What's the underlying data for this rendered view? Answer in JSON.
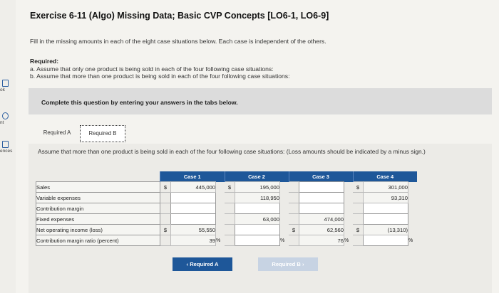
{
  "sidebar": {
    "items": [
      {
        "label": "ok"
      },
      {
        "label": "nt"
      },
      {
        "label": "ences"
      }
    ]
  },
  "title": "Exercise 6-11 (Algo) Missing Data; Basic CVP Concepts [LO6-1, LO6-9]",
  "intro": "Fill in the missing amounts in each of the eight case situations below. Each case is independent of the others.",
  "required": {
    "heading": "Required:",
    "a": "a. Assume that only one product is being sold in each of the four following case situations:",
    "b": "b. Assume that more than one product is being sold in each of the four following case situations:"
  },
  "banner": "Complete this question by entering your answers in the tabs below.",
  "tabs": {
    "a": "Required A",
    "b": "Required B"
  },
  "instruction": "Assume that more than one product is being sold in each of the four following case situations: (Loss amounts should be indicated by a minus sign.)",
  "table": {
    "headers": [
      "Case 1",
      "Case 2",
      "Case 3",
      "Case 4"
    ],
    "rows": [
      {
        "label": "Sales",
        "c1": "445,000",
        "c2": "195,000",
        "c3": "",
        "c4": "301,000"
      },
      {
        "label": "Variable expenses",
        "c1": "",
        "c2": "118,950",
        "c3": "",
        "c4": "93,310"
      },
      {
        "label": "Contribution margin",
        "c1": "",
        "c2": "",
        "c3": "",
        "c4": ""
      },
      {
        "label": "Fixed expenses",
        "c1": "",
        "c2": "63,000",
        "c3": "474,000",
        "c4": ""
      },
      {
        "label": "Net operating income (loss)",
        "c1": "55,550",
        "c2": "",
        "c3": "62,560",
        "c4": "(13,310)"
      },
      {
        "label": "Contribution margin ratio (percent)",
        "c1": "39",
        "c2": "",
        "c3": "76",
        "c4": ""
      }
    ],
    "dollar": "$",
    "percent": "%"
  },
  "buttons": {
    "prev": "Required A",
    "next": "Required B"
  },
  "colors": {
    "accent": "#1e5799",
    "disabled": "#c7d3e3"
  }
}
